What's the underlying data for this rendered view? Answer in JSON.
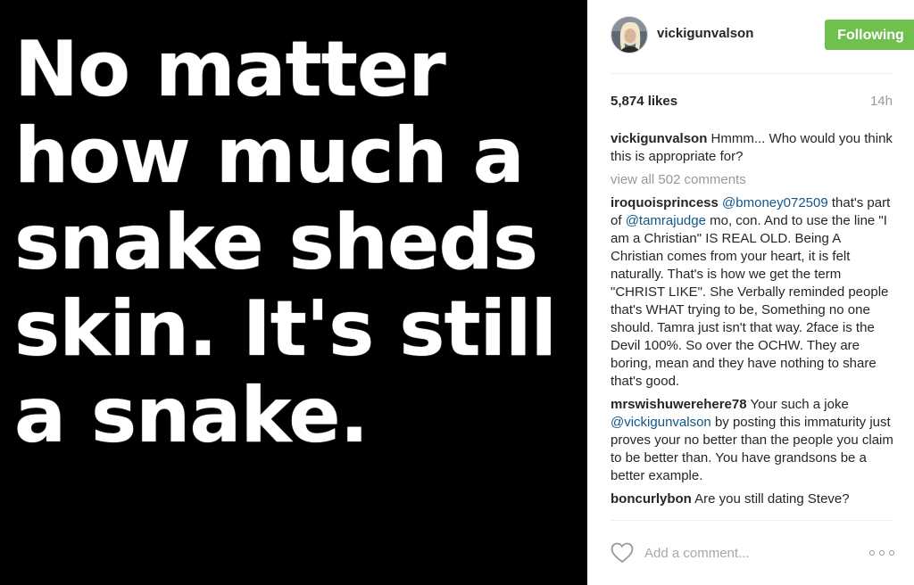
{
  "post": {
    "image_text": "No matter\nhow much a\nsnake sheds\nskin. It's still\na snake.",
    "image_bg": "#000000"
  },
  "header": {
    "username": "vickigunvalson",
    "follow_label": "Following",
    "follow_color": "#70c050"
  },
  "stats": {
    "likes": "5,874 likes",
    "time": "14h"
  },
  "caption": {
    "user": "vickigunvalson",
    "text": " Hmmm... Who would you think this is appropriate for?"
  },
  "view_all": "view all 502 comments",
  "comments": [
    {
      "user": "iroquoisprincess",
      "parts": [
        {
          "t": " "
        },
        {
          "m": "@bmoney072509"
        },
        {
          "t": " that's part of "
        },
        {
          "m": "@tamrajudge"
        },
        {
          "t": " mo, con. And to use the line \"I am a Christian\" IS REAL OLD. Being A Christian comes from your heart, it is felt naturally. That's is how we get the term \"CHRIST LIKE\". She Verbally reminded people that's WHAT trying to be, Something no one should. Tamra just isn't that way. 2face is the Devil 100%. So over the OCHW. They are boring, mean and they have nothing to share that's good."
        }
      ]
    },
    {
      "user": "mrswishuwerehere78",
      "parts": [
        {
          "t": " Your such a joke "
        },
        {
          "m": "@vickigunvalson"
        },
        {
          "t": " by posting this immaturity just proves your no better than the people you claim to be better than. You have grandsons be a better example."
        }
      ]
    },
    {
      "user": "boncurlybon",
      "parts": [
        {
          "t": " Are you still dating Steve?"
        }
      ]
    }
  ],
  "actions": {
    "comment_placeholder": "Add a comment...",
    "like_icon": "heart-outline-icon",
    "more_icon": "more-options-icon"
  }
}
